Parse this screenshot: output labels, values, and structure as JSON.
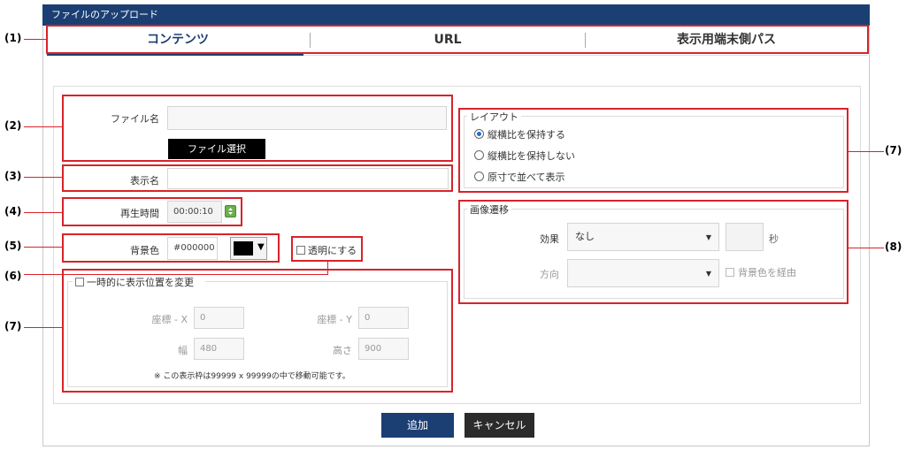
{
  "dialog": {
    "title": "ファイルのアップロード"
  },
  "tabs": [
    {
      "label": "コンテンツ",
      "active": true
    },
    {
      "label": "URL",
      "active": false
    },
    {
      "label": "表示用端末側パス",
      "active": false
    }
  ],
  "annotations": [
    "(1)",
    "(2)",
    "(3)",
    "(4)",
    "(5)",
    "(6)",
    "(7)",
    "(7)",
    "(8)"
  ],
  "file": {
    "label": "ファイル名",
    "value": "",
    "button": "ファイル選択"
  },
  "display_name": {
    "label": "表示名",
    "value": ""
  },
  "play_time": {
    "label": "再生時間",
    "value": "00:00:10"
  },
  "bg_color": {
    "label": "背景色",
    "value": "#000000",
    "swatch": "#000000",
    "transparent_label": "透明にする"
  },
  "temp_position": {
    "checkbox_label": "一時的に表示位置を変更",
    "x_label": "座標 - X",
    "x_value": "0",
    "y_label": "座標 - Y",
    "y_value": "0",
    "width_label": "幅",
    "width_value": "480",
    "height_label": "高さ",
    "height_value": "900",
    "note": "※ この表示枠は99999 x 99999の中で移動可能です。"
  },
  "layout": {
    "title": "レイアウト",
    "options": [
      {
        "label": "縦横比を保持する",
        "checked": true
      },
      {
        "label": "縦横比を保持しない",
        "checked": false
      },
      {
        "label": "原寸で並べて表示",
        "checked": false
      }
    ]
  },
  "transition": {
    "title": "画像遷移",
    "effect_label": "効果",
    "effect_value": "なし",
    "seconds_value": "",
    "seconds_unit": "秒",
    "direction_label": "方向",
    "direction_value": "",
    "via_bg_label": "背景色を経由"
  },
  "actions": {
    "add": "追加",
    "cancel": "キャンセル"
  },
  "colors": {
    "accent": "#1b3f72",
    "annotation": "#d8232a"
  }
}
